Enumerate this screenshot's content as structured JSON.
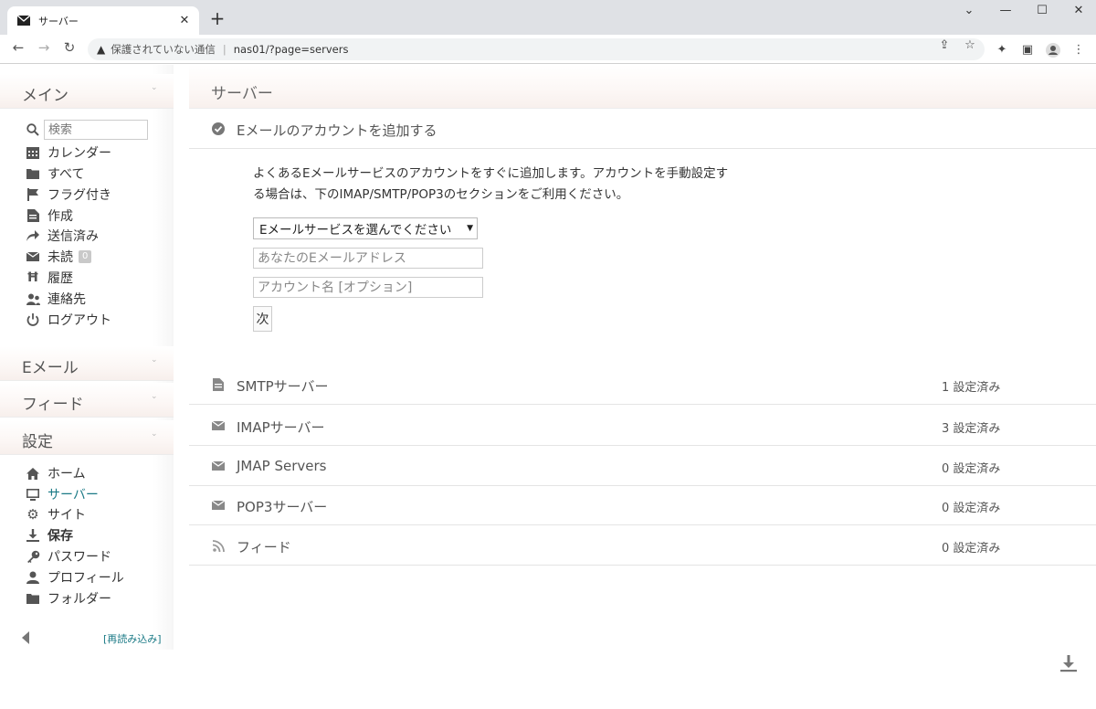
{
  "browser": {
    "tab_title": "サーバー",
    "tab_close": "✕",
    "new_tab": "+",
    "security_label": "保護されていない通信",
    "url": "nas01/?page=servers",
    "window_buttons": {
      "minimize": "—",
      "maximize": "☐",
      "close": "✕",
      "tab_search": "⌄"
    }
  },
  "sidebar": {
    "sections": {
      "main": "メイン",
      "email": "Eメール",
      "feeds": "フィード",
      "settings": "設定"
    },
    "search_placeholder": "検索",
    "main_items": [
      {
        "label": "カレンダー",
        "icon": "calendar-icon"
      },
      {
        "label": "すべて",
        "icon": "folder-icon"
      },
      {
        "label": "フラグ付き",
        "icon": "flag-icon"
      },
      {
        "label": "作成",
        "icon": "compose-icon"
      },
      {
        "label": "送信済み",
        "icon": "sent-icon"
      },
      {
        "label": "未読",
        "icon": "envelope-icon",
        "badge": "0"
      },
      {
        "label": "履歴",
        "icon": "history-icon"
      },
      {
        "label": "連絡先",
        "icon": "contacts-icon"
      },
      {
        "label": "ログアウト",
        "icon": "power-icon"
      }
    ],
    "settings_items": [
      {
        "label": "ホーム",
        "icon": "home-icon"
      },
      {
        "label": "サーバー",
        "icon": "monitor-icon",
        "active": true
      },
      {
        "label": "サイト",
        "icon": "gear-icon"
      },
      {
        "label": "保存",
        "icon": "download-icon",
        "bold": true
      },
      {
        "label": "パスワード",
        "icon": "key-icon"
      },
      {
        "label": "プロフィール",
        "icon": "user-icon"
      },
      {
        "label": "フォルダー",
        "icon": "folder-icon"
      }
    ],
    "reload_label": "[再読み込み]"
  },
  "content": {
    "title": "サーバー",
    "add_account": {
      "title": "Eメールのアカウントを追加する",
      "description": "よくあるEメールサービスのアカウントをすぐに追加します。アカウントを手動設定する場合は、下のIMAP/SMTP/POP3のセクションをご利用ください。",
      "select_value": "Eメールサービスを選んでください",
      "email_placeholder": "あなたのEメールアドレス",
      "account_placeholder": "アカウント名 [オプション]",
      "next_label": "次"
    },
    "servers": [
      {
        "label": "SMTPサーバー",
        "count": "1 設定済み",
        "icon": "document-icon"
      },
      {
        "label": "IMAPサーバー",
        "count": "3 設定済み",
        "icon": "envelope-icon"
      },
      {
        "label": "JMAP Servers",
        "count": "0 設定済み",
        "icon": "envelope-icon"
      },
      {
        "label": "POP3サーバー",
        "count": "0 設定済み",
        "icon": "envelope-icon"
      },
      {
        "label": "フィード",
        "count": "0 設定済み",
        "icon": "rss-icon"
      }
    ]
  },
  "colors": {
    "accent": "#1b7a86",
    "badge": "#c9c9c9"
  }
}
